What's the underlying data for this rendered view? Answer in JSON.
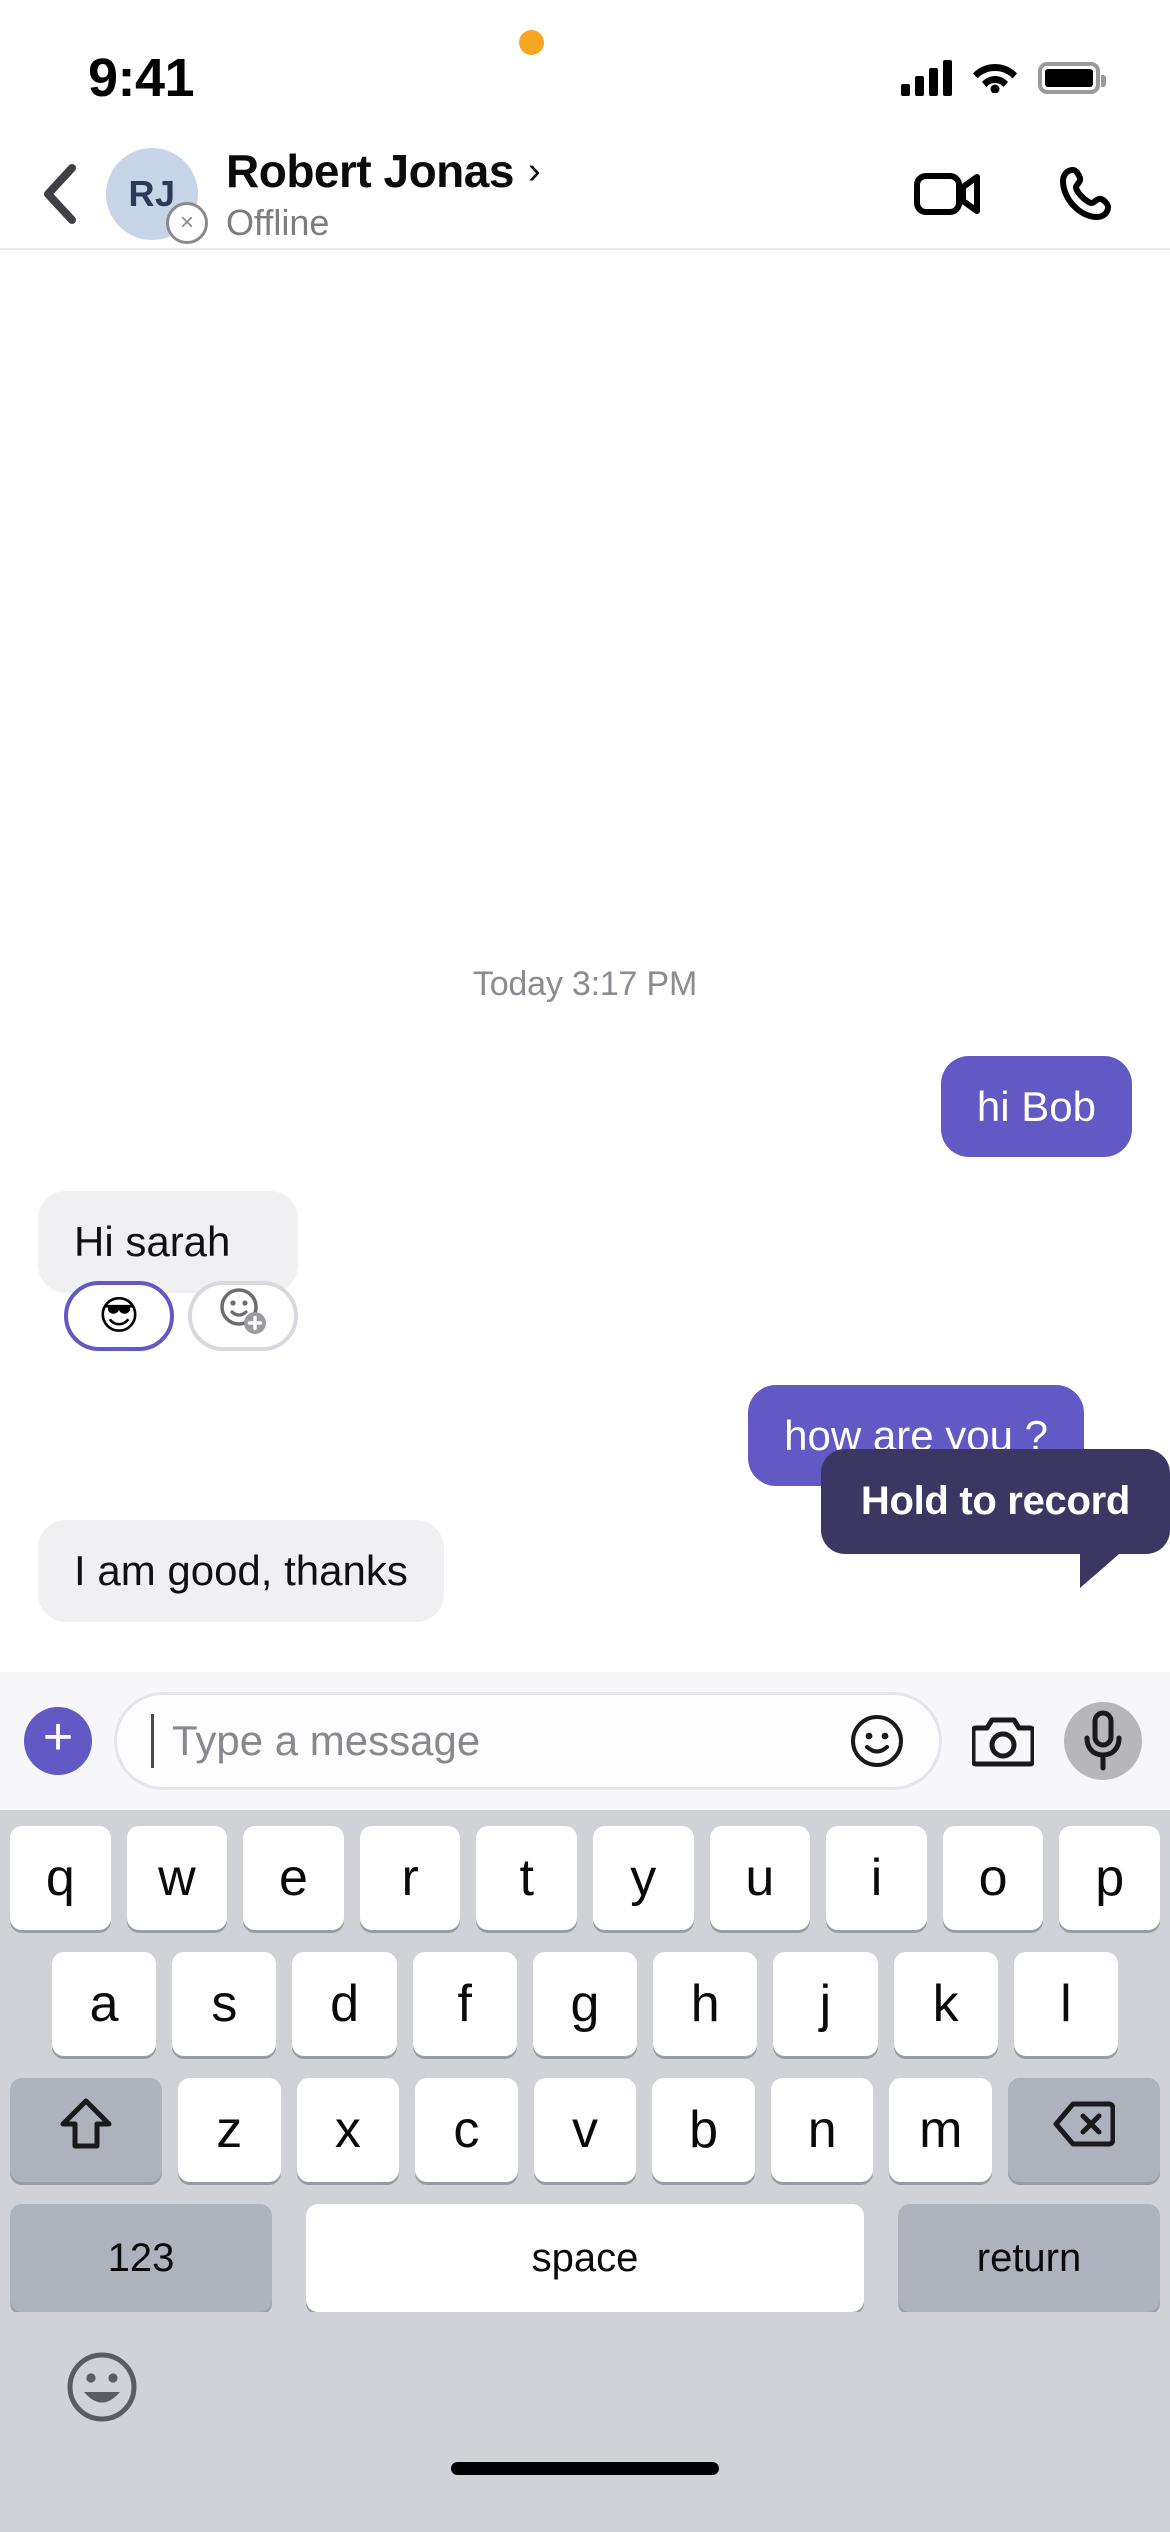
{
  "status_bar": {
    "time": "9:41",
    "privacy_indicator": "orange-dot",
    "signal_icon": "cellular-signal-icon",
    "wifi_icon": "wifi-icon",
    "battery_icon": "battery-icon"
  },
  "header": {
    "back_icon": "chevron-left-icon",
    "avatar_initials": "RJ",
    "presence_glyph": "×",
    "presence_state": "offline",
    "name": "Robert Jonas",
    "name_chevron": "›",
    "status": "Offline",
    "video_call_icon": "video-camera-icon",
    "voice_call_icon": "phone-icon"
  },
  "conversation": {
    "day_divider": "Today 3:17 PM",
    "messages": [
      {
        "id": "m1",
        "direction": "out",
        "text": "hi Bob",
        "has_receipt": false
      },
      {
        "id": "m2",
        "direction": "in",
        "text": "Hi sarah",
        "has_reactions": true
      },
      {
        "id": "m3",
        "direction": "out",
        "text": "how are you ?",
        "has_receipt": true
      },
      {
        "id": "m4",
        "direction": "in",
        "text": "I am good, thanks",
        "has_reactions": false
      }
    ],
    "reactions": [
      {
        "emoji": "😎",
        "name": "sunglasses-reaction",
        "selected": true
      },
      {
        "emoji": "add",
        "name": "add-reaction",
        "selected": false
      }
    ],
    "read_receipt_icon": "seen-indicator-icon"
  },
  "tooltip": {
    "text": "Hold to record"
  },
  "input_bar": {
    "plus_label": "+",
    "placeholder": "Type a message",
    "value": "",
    "emoji_icon": "smiley-icon",
    "camera_icon": "camera-icon",
    "mic_icon": "microphone-icon",
    "mic_pressed": true
  },
  "keyboard": {
    "row1": [
      "q",
      "w",
      "e",
      "r",
      "t",
      "y",
      "u",
      "i",
      "o",
      "p"
    ],
    "row2": [
      "a",
      "s",
      "d",
      "f",
      "g",
      "h",
      "j",
      "k",
      "l"
    ],
    "row3": [
      "z",
      "x",
      "c",
      "v",
      "b",
      "n",
      "m"
    ],
    "shift_icon": "shift-arrow-icon",
    "backspace_icon": "backspace-icon",
    "numbers_label": "123",
    "space_label": "space",
    "return_label": "return",
    "emoji_key_icon": "emoji-face-icon"
  },
  "colors": {
    "accent_purple": "#6159c4",
    "tooltip_navy": "#3c3663",
    "incoming_bubble": "#f0f0f3",
    "keyboard_bg": "#d0d2d8",
    "modifier_key": "#aeb2bd",
    "avatar_bg": "#c8d5e8",
    "privacy_orange": "#f5a623"
  }
}
